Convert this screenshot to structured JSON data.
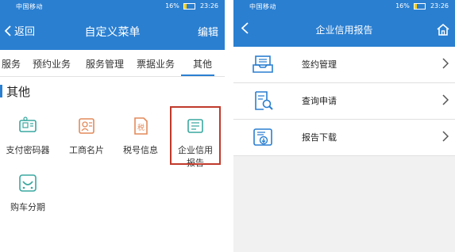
{
  "left_phone": {
    "status": {
      "carrier": "中国移动",
      "battery": "16%",
      "time": "23:26"
    },
    "nav": {
      "back_label": "返回",
      "title": "自定义菜单",
      "edit_label": "编辑"
    },
    "tabs": [
      "服务",
      "预约业务",
      "服务管理",
      "票据业务",
      "其他"
    ],
    "active_tab": "其他",
    "section_title": "其他",
    "items": [
      {
        "label": "支付密码器",
        "icon": "payment-password-device-icon"
      },
      {
        "label": "工商名片",
        "icon": "business-card-icon"
      },
      {
        "label": "税号信息",
        "icon": "tax-id-icon"
      },
      {
        "label": "企业信用\n报告",
        "line1": "企业信用",
        "line2": "报告",
        "icon": "credit-report-icon"
      },
      {
        "label": "购车分期",
        "icon": "car-installment-icon"
      }
    ]
  },
  "right_phone": {
    "status": {
      "carrier": "中国移动",
      "battery": "16%",
      "time": "23:26"
    },
    "nav": {
      "title": "企业信用报告"
    },
    "list": [
      {
        "label": "签约管理",
        "icon": "contract-tray-icon"
      },
      {
        "label": "查询申请",
        "icon": "document-search-icon"
      },
      {
        "label": "报告下载",
        "icon": "download-report-icon"
      }
    ]
  },
  "colors": {
    "brand_blue": "#2a7fd1",
    "highlight_red": "#c0392b",
    "icon_teal": "#3aa8a0",
    "icon_orange": "#e38a5a"
  }
}
